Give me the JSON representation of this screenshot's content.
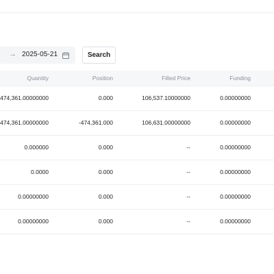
{
  "filters": {
    "range_separator": "→",
    "end_date": "2025-05-21",
    "calendar_icon": "calendar-icon",
    "search_label": "Search"
  },
  "table": {
    "headers": {
      "quantity": "Quantity",
      "position": "Position",
      "filled_price": "Filled Price",
      "funding": "Funding"
    },
    "rows": [
      {
        "quantity": "474,361.00000000",
        "position": "0.000",
        "filled_price": "106,537.10000000",
        "funding": "0.00000000"
      },
      {
        "quantity": "474,361.00000000",
        "position": "-474,361.000",
        "filled_price": "106,631.00000000",
        "funding": "0.00000000"
      },
      {
        "quantity": "0.000000",
        "position": "0.000",
        "filled_price": "--",
        "funding": "0.00000000"
      },
      {
        "quantity": "0.0000",
        "position": "0.000",
        "filled_price": "--",
        "funding": "0.00000000"
      },
      {
        "quantity": "0.00000000",
        "position": "0.000",
        "filled_price": "--",
        "funding": "0.00000000"
      },
      {
        "quantity": "0.00000000",
        "position": "0.000",
        "filled_price": "--",
        "funding": "0.00000000"
      }
    ]
  }
}
